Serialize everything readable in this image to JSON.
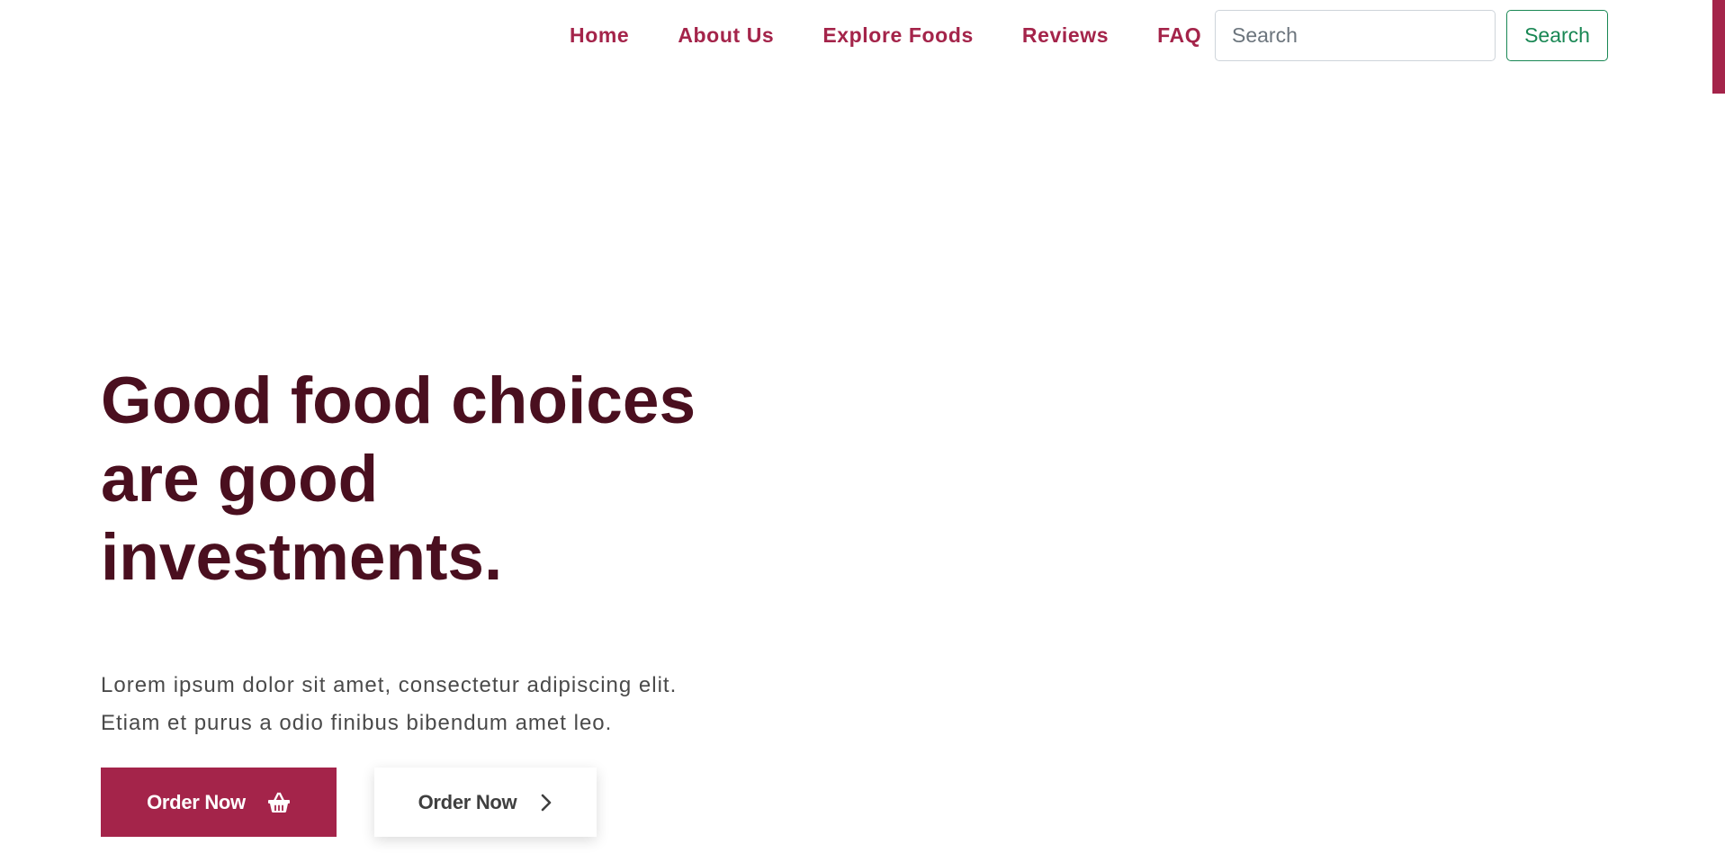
{
  "nav": {
    "items": [
      {
        "label": "Home"
      },
      {
        "label": "About Us"
      },
      {
        "label": "Explore Foods"
      },
      {
        "label": "Reviews"
      },
      {
        "label": "FAQ"
      }
    ],
    "search": {
      "placeholder": "Search",
      "value": "",
      "button_label": "Search"
    }
  },
  "hero": {
    "title_lines": [
      "Good food choices",
      "are good",
      "investments."
    ],
    "description_lines": [
      "Lorem ipsum dolor sit amet, consectetur adipiscing elit.",
      "Etiam et purus a odio finibus bibendum amet leo."
    ],
    "primary_button": {
      "label": "Order Now",
      "icon": "basket-icon"
    },
    "secondary_button": {
      "label": "Order Now",
      "icon": "chevron-right-icon"
    }
  },
  "colors": {
    "brand": "#a4244a",
    "title": "#4a0f1f",
    "body_text": "#4a4a4a",
    "search_button": "#198754"
  }
}
